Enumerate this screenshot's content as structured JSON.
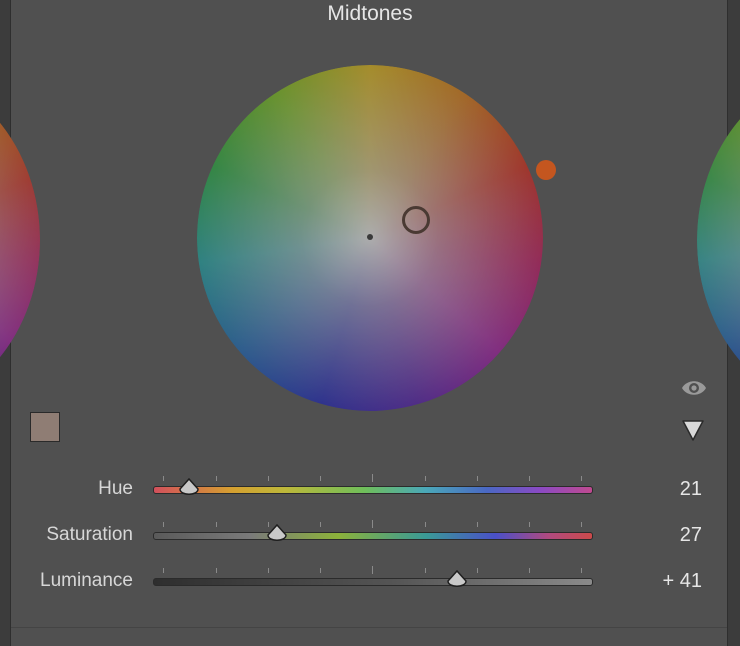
{
  "panel": {
    "title": "Midtones"
  },
  "colors": {
    "swatch": "#8f7d74",
    "hue_handle": "#c4561f",
    "panel_bg": "#505050"
  },
  "icons": {
    "visibility": "eye-icon",
    "menu": "triangle-down-icon"
  },
  "sliders": [
    {
      "label": "Hue",
      "value": "21"
    },
    {
      "label": "Saturation",
      "value": "27"
    },
    {
      "label": "Luminance",
      "value": "+ 41"
    }
  ]
}
